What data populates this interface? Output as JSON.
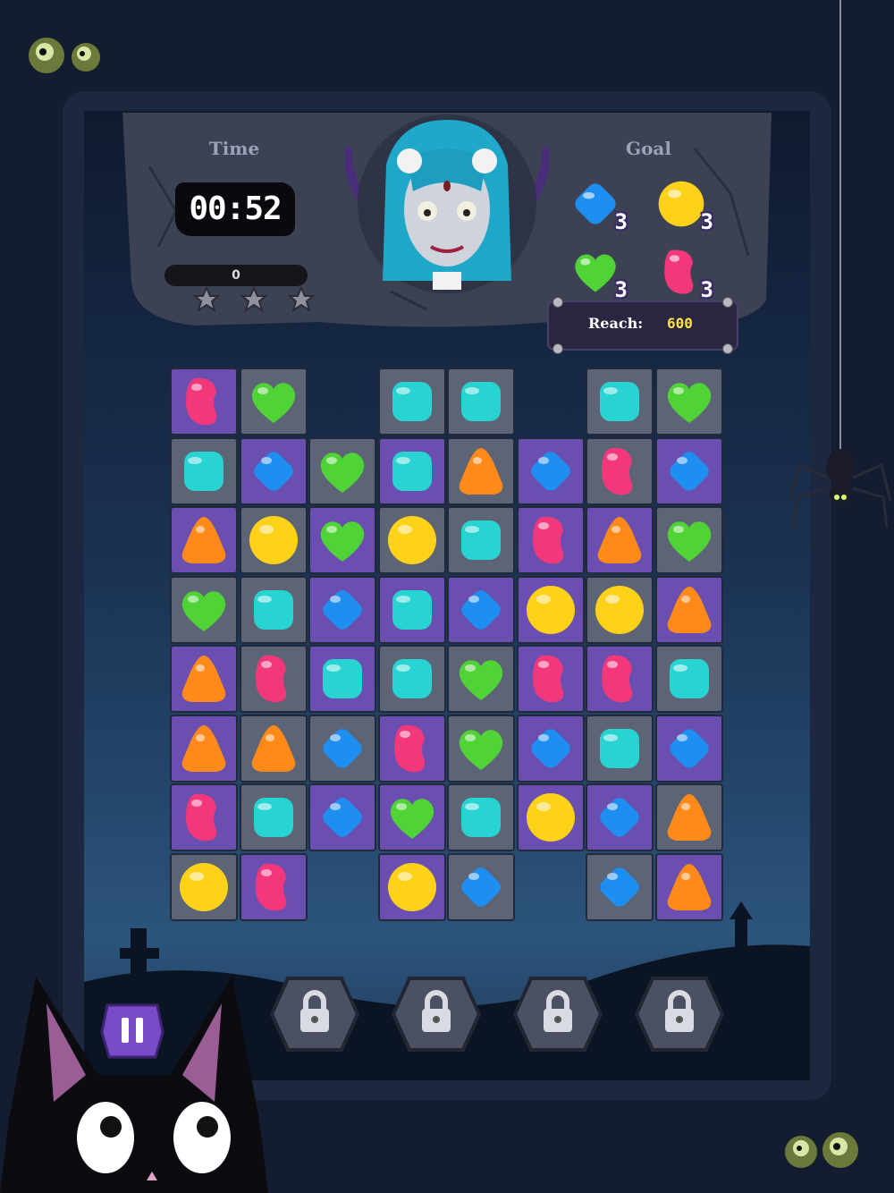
{
  "hud": {
    "time_label": "Time",
    "time_value": "00:52",
    "score_value": "0",
    "goal_label": "Goal",
    "reach_label": "Reach:",
    "reach_value": "600"
  },
  "goals": [
    {
      "candy": "blue-diamond",
      "count": "3"
    },
    {
      "candy": "yellow-round",
      "count": "3"
    },
    {
      "candy": "green-heart",
      "count": "3"
    },
    {
      "candy": "pink-bean",
      "count": "3"
    }
  ],
  "stars": [
    "star-icon",
    "star-icon",
    "star-icon"
  ],
  "board": {
    "rows": [
      [
        "P:pink",
        "G:green",
        "",
        "G:teal",
        "G:teal",
        "",
        "G:teal",
        "G:green"
      ],
      [
        "G:teal",
        "P:blue",
        "G:green",
        "P:teal",
        "G:orange",
        "P:blue",
        "G:pink",
        "P:blue"
      ],
      [
        "P:orange",
        "G:yellow",
        "P:green",
        "G:yellow",
        "G:teal",
        "P:pink",
        "P:orange",
        "G:green"
      ],
      [
        "G:green",
        "G:teal",
        "P:blue",
        "P:teal",
        "P:blue",
        "P:yellow",
        "G:yellow",
        "P:orange"
      ],
      [
        "P:orange",
        "G:pink",
        "P:teal",
        "G:teal",
        "G:green",
        "P:pink",
        "P:pink",
        "G:teal"
      ],
      [
        "P:orange",
        "G:orange",
        "G:blue",
        "P:pink",
        "G:green",
        "P:blue",
        "G:teal",
        "P:blue"
      ],
      [
        "P:pink",
        "G:teal",
        "P:blue",
        "P:green",
        "G:teal",
        "P:yellow",
        "P:blue",
        "G:orange"
      ],
      [
        "G:yellow",
        "P:pink",
        "",
        "P:yellow",
        "G:blue",
        "",
        "G:blue",
        "P:orange"
      ]
    ]
  },
  "colors": {
    "teal": "#27d4d2",
    "blue": "#1e8ef0",
    "green": "#4fd336",
    "pink": "#f2387a",
    "orange": "#ff8a1a",
    "yellow": "#ffd21a"
  },
  "boosters": [
    "lock-icon",
    "lock-icon",
    "lock-icon",
    "lock-icon"
  ],
  "pause_icon": "pause-icon"
}
